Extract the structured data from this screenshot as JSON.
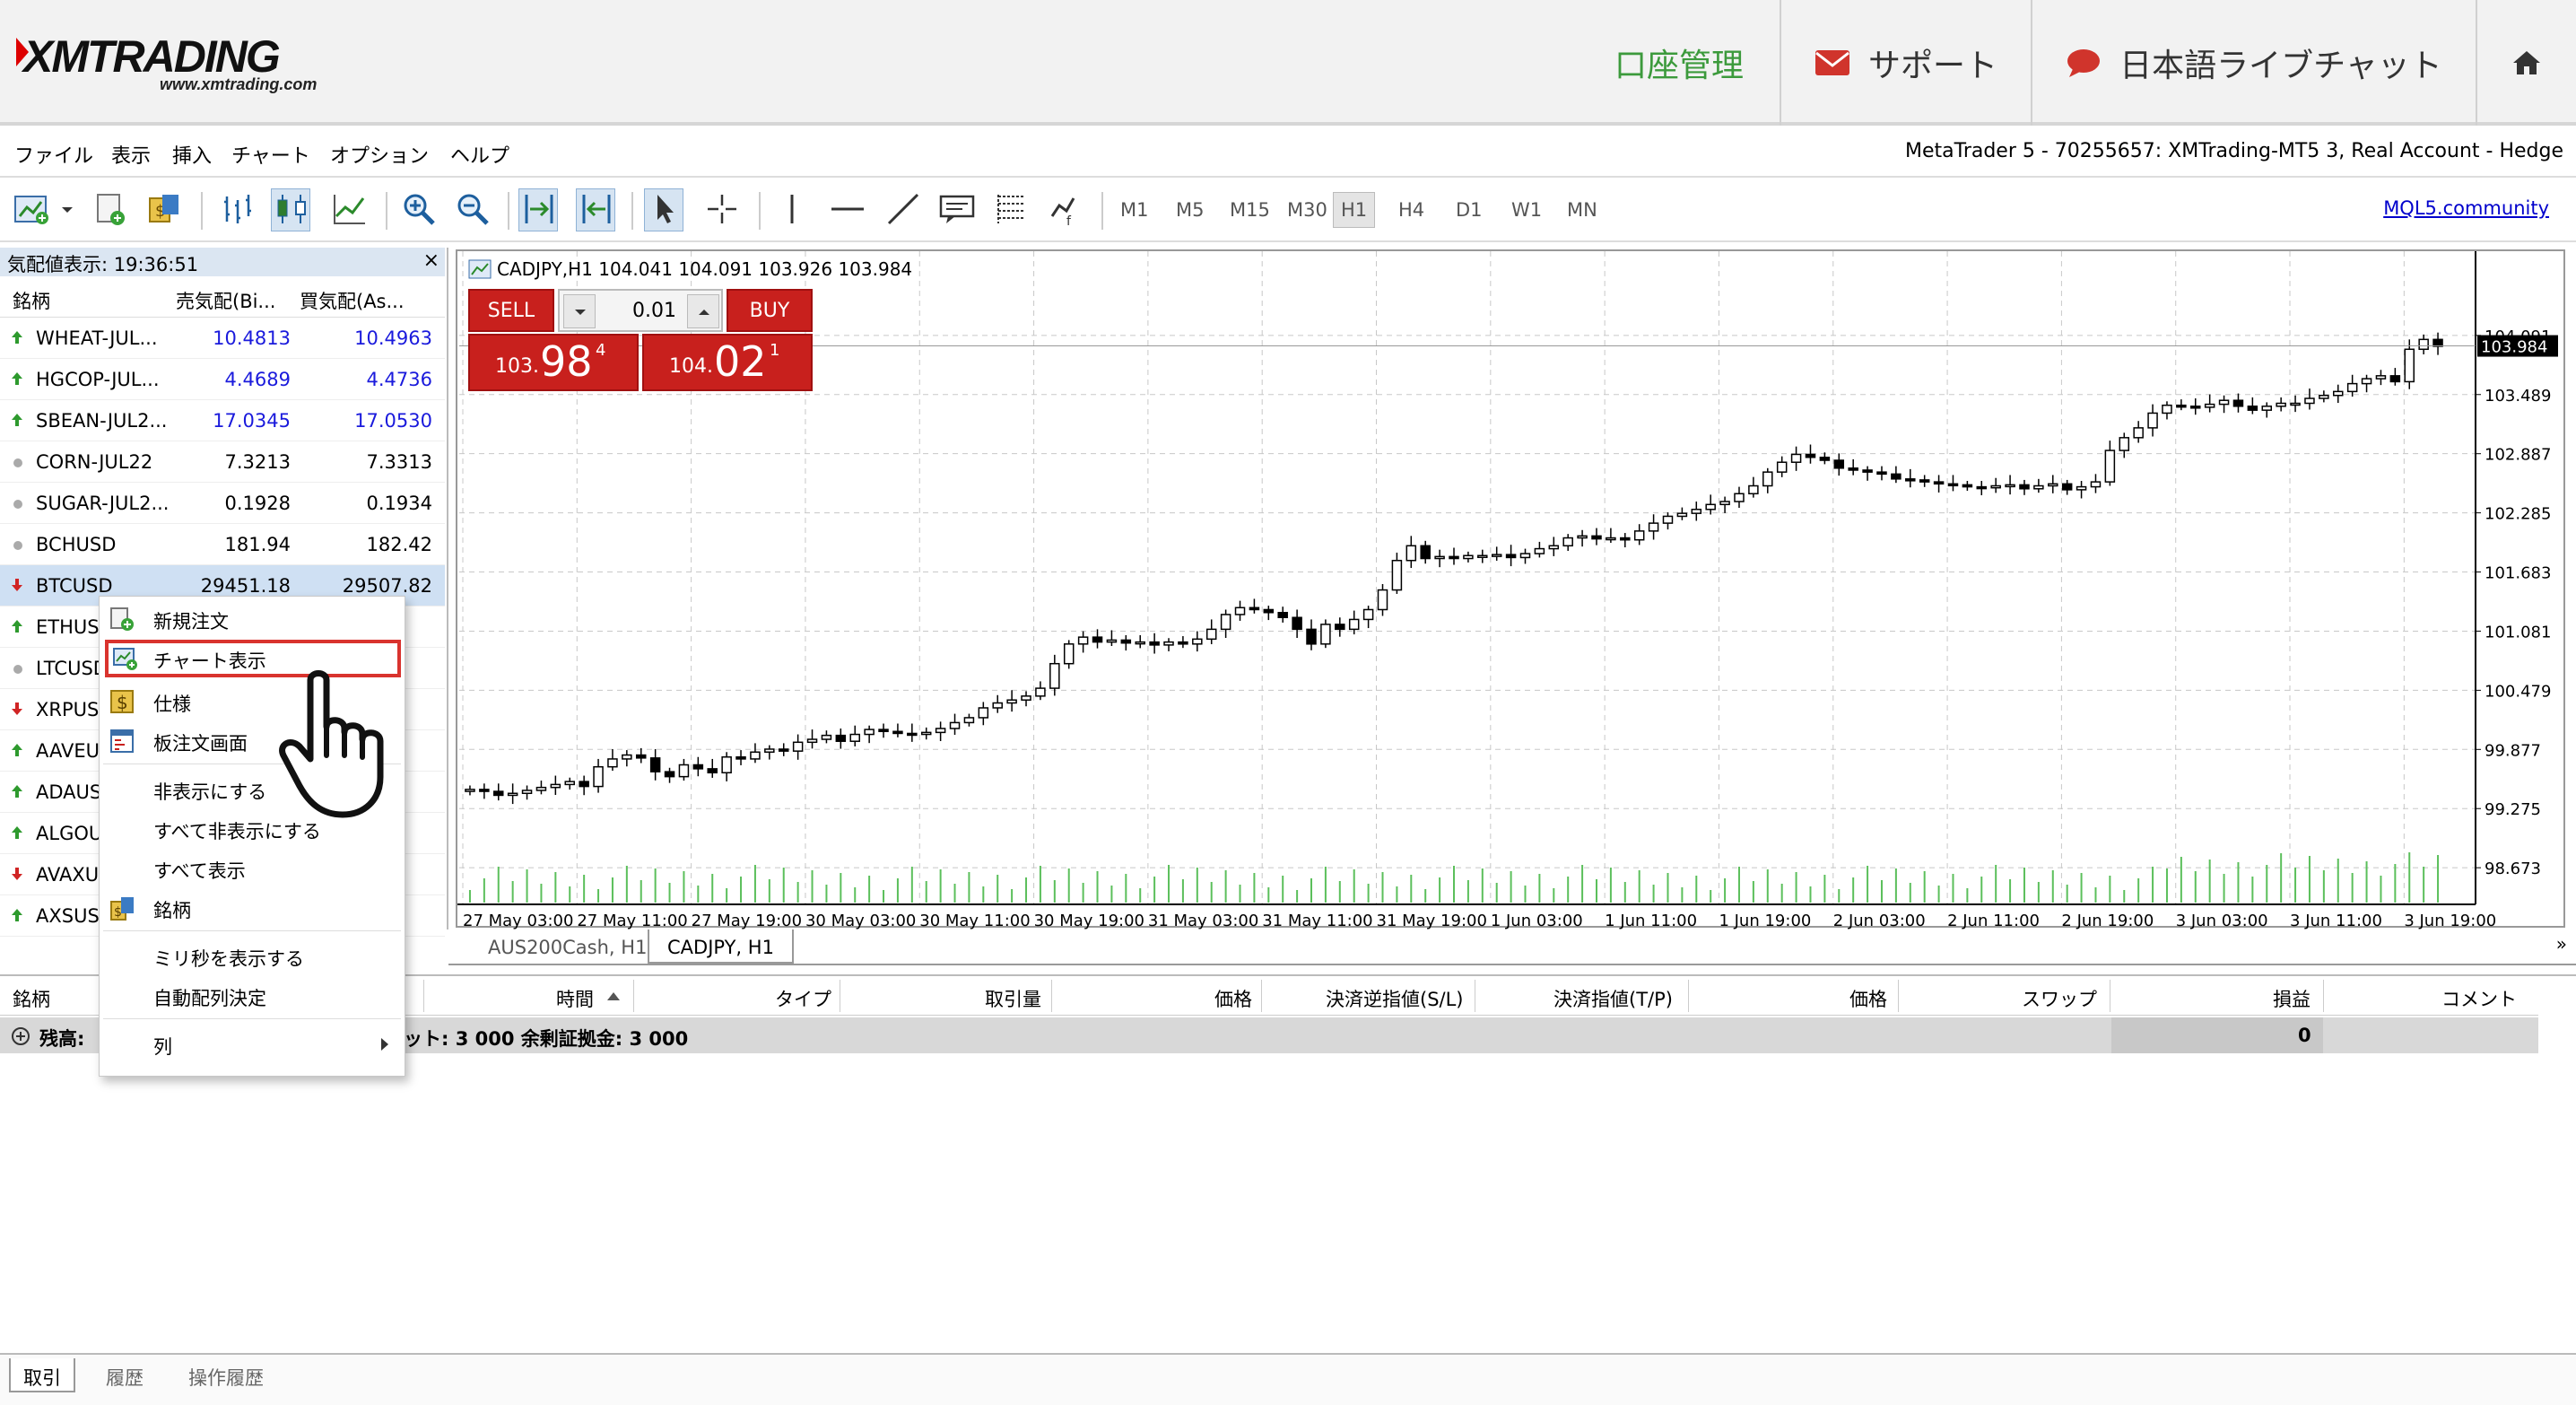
{
  "header": {
    "logo_text": "XMTRADING",
    "logo_url": "www.xmtrading.com",
    "nav": [
      {
        "label": "口座管理",
        "icon": "none"
      },
      {
        "label": "サポート",
        "icon": "envelope-icon"
      },
      {
        "label": "日本語ライブチャット",
        "icon": "chat-bubble-icon"
      }
    ],
    "home_icon": "home-icon"
  },
  "menubar": {
    "items": [
      "ファイル",
      "表示",
      "挿入",
      "チャート",
      "オプション",
      "ヘルプ"
    ],
    "title": "MetaTrader 5 - 70255657: XMTrading-MT5 3, Real Account - Hedge"
  },
  "toolbar": {
    "timeframes": [
      "M1",
      "M5",
      "M15",
      "M30",
      "H1",
      "H4",
      "D1",
      "W1",
      "MN"
    ],
    "selected_timeframe": "H1",
    "community_link": "MQL5.community"
  },
  "market_watch": {
    "title": "気配値表示: 19:36:51",
    "columns": [
      "銘柄",
      "売気配(Bi...",
      "買気配(As..."
    ],
    "rows": [
      {
        "symbol": "WHEAT-JUL...",
        "bid": "10.4813",
        "ask": "10.4963",
        "dir": "up",
        "color": "#1a1adc"
      },
      {
        "symbol": "HGCOP-JUL...",
        "bid": "4.4689",
        "ask": "4.4736",
        "dir": "up",
        "color": "#1a1adc"
      },
      {
        "symbol": "SBEAN-JUL2...",
        "bid": "17.0345",
        "ask": "17.0530",
        "dir": "up",
        "color": "#1a1adc"
      },
      {
        "symbol": "CORN-JUL22",
        "bid": "7.3213",
        "ask": "7.3313",
        "dir": "none",
        "color": "#000000"
      },
      {
        "symbol": "SUGAR-JUL2...",
        "bid": "0.1928",
        "ask": "0.1934",
        "dir": "none",
        "color": "#000000"
      },
      {
        "symbol": "BCHUSD",
        "bid": "181.94",
        "ask": "182.42",
        "dir": "none",
        "color": "#000000"
      },
      {
        "symbol": "BTCUSD",
        "bid": "29451.18",
        "ask": "29507.82",
        "dir": "down",
        "color": "#000000"
      },
      {
        "symbol": "ETHUS",
        "bid": "",
        "ask": "",
        "dir": "up",
        "color": "#000000"
      },
      {
        "symbol": "LTCUSD",
        "bid": "",
        "ask": "",
        "dir": "none",
        "color": "#000000"
      },
      {
        "symbol": "XRPUS",
        "bid": "",
        "ask": "",
        "dir": "down",
        "color": "#000000"
      },
      {
        "symbol": "AAVEU",
        "bid": "",
        "ask": "",
        "dir": "up",
        "color": "#000000"
      },
      {
        "symbol": "ADAUS",
        "bid": "",
        "ask": "",
        "dir": "up",
        "color": "#000000"
      },
      {
        "symbol": "ALGOU",
        "bid": "",
        "ask": "",
        "dir": "up",
        "color": "#000000"
      },
      {
        "symbol": "AVAXU",
        "bid": "",
        "ask": "",
        "dir": "down",
        "color": "#000000"
      },
      {
        "symbol": "AXSUS",
        "bid": "",
        "ask": "",
        "dir": "up",
        "color": "#000000"
      }
    ],
    "tab_label": "銘柄"
  },
  "chart": {
    "caption": "CADJPY,H1  104.041 104.091 103.926 103.984",
    "price_labels": [
      "104.091",
      "103.489",
      "102.887",
      "102.285",
      "101.683",
      "101.081",
      "100.479",
      "99.877",
      "99.275",
      "98.673"
    ],
    "current_price": "103.984",
    "time_labels": [
      "27 May 03:00",
      "27 May 11:00",
      "27 May 19:00",
      "30 May 03:00",
      "30 May 11:00",
      "30 May 19:00",
      "31 May 03:00",
      "31 May 11:00",
      "31 May 19:00",
      "1 Jun 03:00",
      "1 Jun 11:00",
      "1 Jun 19:00",
      "2 Jun 03:00",
      "2 Jun 11:00",
      "2 Jun 19:00",
      "3 Jun 03:00",
      "3 Jun 11:00",
      "3 Jun 19:00"
    ],
    "grid": true
  },
  "chart_data": {
    "type": "candlestick",
    "symbol": "CADJPY",
    "timeframe": "H1",
    "ylim": [
      98.3,
      104.4
    ],
    "ohlc_last": {
      "open": 104.041,
      "high": 104.091,
      "low": 103.926,
      "close": 103.984
    },
    "close": [
      99.47,
      99.45,
      99.41,
      99.43,
      99.46,
      99.49,
      99.52,
      99.55,
      99.5,
      99.7,
      99.78,
      99.82,
      99.79,
      99.65,
      99.6,
      99.72,
      99.68,
      99.64,
      99.8,
      99.78,
      99.85,
      99.88,
      99.86,
      99.95,
      99.98,
      100.02,
      99.96,
      100.03,
      100.08,
      100.06,
      100.04,
      100.03,
      100.05,
      100.09,
      100.15,
      100.2,
      100.3,
      100.35,
      100.38,
      100.42,
      100.5,
      100.75,
      100.95,
      101.02,
      100.97,
      100.99,
      100.96,
      100.97,
      100.94,
      100.97,
      100.95,
      101.0,
      101.1,
      101.25,
      101.32,
      101.3,
      101.27,
      101.22,
      101.1,
      100.95,
      101.15,
      101.1,
      101.2,
      101.3,
      101.5,
      101.8,
      101.95,
      101.82,
      101.84,
      101.82,
      101.85,
      101.85,
      101.86,
      101.83,
      101.87,
      101.92,
      101.95,
      102.03,
      102.05,
      102.02,
      102.03,
      102.01,
      102.1,
      102.18,
      102.25,
      102.28,
      102.32,
      102.37,
      102.4,
      102.48,
      102.56,
      102.7,
      102.8,
      102.88,
      102.85,
      102.82,
      102.74,
      102.72,
      102.7,
      102.68,
      102.63,
      102.62,
      102.6,
      102.58,
      102.57,
      102.55,
      102.54,
      102.56,
      102.57,
      102.53,
      102.56,
      102.58,
      102.52,
      102.55,
      102.6,
      102.92,
      103.05,
      103.15,
      103.3,
      103.38,
      103.37,
      103.36,
      103.39,
      103.43,
      103.37,
      103.33,
      103.37,
      103.4,
      103.4,
      103.45,
      103.48,
      103.52,
      103.6,
      103.65,
      103.68,
      103.62,
      103.95,
      104.05,
      103.98
    ],
    "volume_note": "tick volume bars at bottom"
  },
  "one_click": {
    "sell_label": "SELL",
    "buy_label": "BUY",
    "lot": "0.01",
    "sell_prefix": "103.",
    "sell_big": "98",
    "sell_sup": "4",
    "buy_prefix": "104.",
    "buy_big": "02",
    "buy_sup": "1"
  },
  "chart_tabs": [
    "AUS200Cash, H1",
    "CADJPY, H1"
  ],
  "chart_tabs_active": "CADJPY, H1",
  "terminal": {
    "columns": [
      "銘柄",
      "時間",
      "タイプ",
      "取引量",
      "価格",
      "決済逆指値(S/L)",
      "決済指値(T/P)",
      "価格",
      "スワップ",
      "損益",
      "コメント"
    ],
    "balance_row_left": "残高: ",
    "balance_row_right": "ット: 3 000  余剰証拠金: 3 000",
    "profit": "0",
    "tabs": [
      "取引",
      "履歴",
      "操作履歴"
    ]
  },
  "context_menu": {
    "items": [
      {
        "label": "新規注文",
        "icon": "new-order-icon"
      },
      {
        "label": "チャート表示",
        "icon": "chart-window-icon",
        "highlighted": true
      },
      {
        "label": "仕様",
        "icon": "dollar-spec-icon"
      },
      {
        "label": "板注文画面",
        "icon": "depth-of-market-icon"
      },
      {
        "label": "非表示にする",
        "icon": ""
      },
      {
        "label": "すべて非表示にする",
        "icon": ""
      },
      {
        "label": "すべて表示",
        "icon": ""
      },
      {
        "label": "銘柄",
        "icon": "symbols-icon"
      },
      {
        "label": "ミリ秒を表示する",
        "icon": ""
      },
      {
        "label": "自動配列決定",
        "icon": ""
      },
      {
        "label": "列",
        "icon": "submenu-arrow-icon"
      }
    ]
  },
  "colors": {
    "accent_green": "#3c9a3c",
    "sell_red": "#c8201d",
    "link_blue": "#0000cc",
    "highlight_red": "#d9332e"
  }
}
